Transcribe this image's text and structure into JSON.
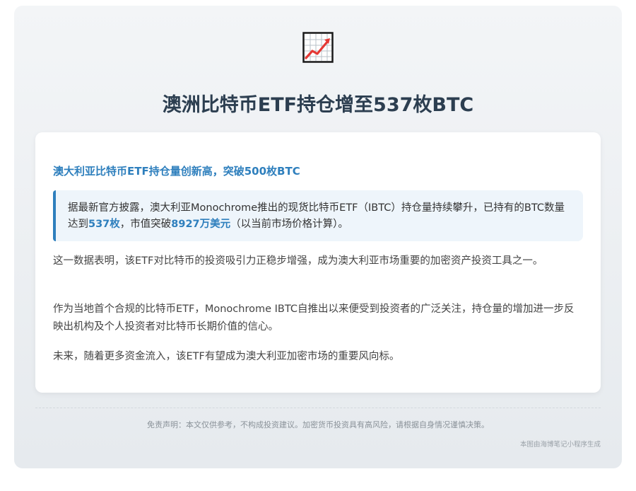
{
  "header": {
    "logo_icon": "chart-increasing-icon",
    "title": "澳洲比特币ETF持仓增至537枚BTC"
  },
  "card": {
    "headline": "澳大利亚比特币ETF持仓量创新高，突破500枚BTC",
    "highlight": {
      "text_1": "据最新官方披露，澳大利亚Monochrome推出的现货比特币ETF（IBTC）持仓量持续攀升，已持有的BTC数量达到",
      "holding": "537枚",
      "text_2": "，市值突破",
      "value": "8927万美元",
      "text_3": "（以当前市场价格计算）。"
    },
    "paragraphs": [
      "这一数据表明，该ETF对比特币的投资吸引力正稳步增强，成为澳大利亚市场重要的加密资产投资工具之一。",
      "作为当地首个合规的比特币ETF，Monochrome IBTC自推出以来便受到投资者的广泛关注，持仓量的增加进一步反映出机构及个人投资者对比特币长期价值的信心。",
      "未来，随着更多资金流入，该ETF有望成为澳大利亚加密市场的重要风向标。"
    ]
  },
  "footer": {
    "disclaimer": "免责声明：本文仅供参考，不构成投资建议。加密货币投资具有高风险，请根据自身情况谨慎决策。",
    "credit": "本图由海博笔记小程序生成"
  },
  "colors": {
    "accent": "#2e7fbd",
    "title": "#2c3e50",
    "highlight_bg": "#eef5fb"
  }
}
